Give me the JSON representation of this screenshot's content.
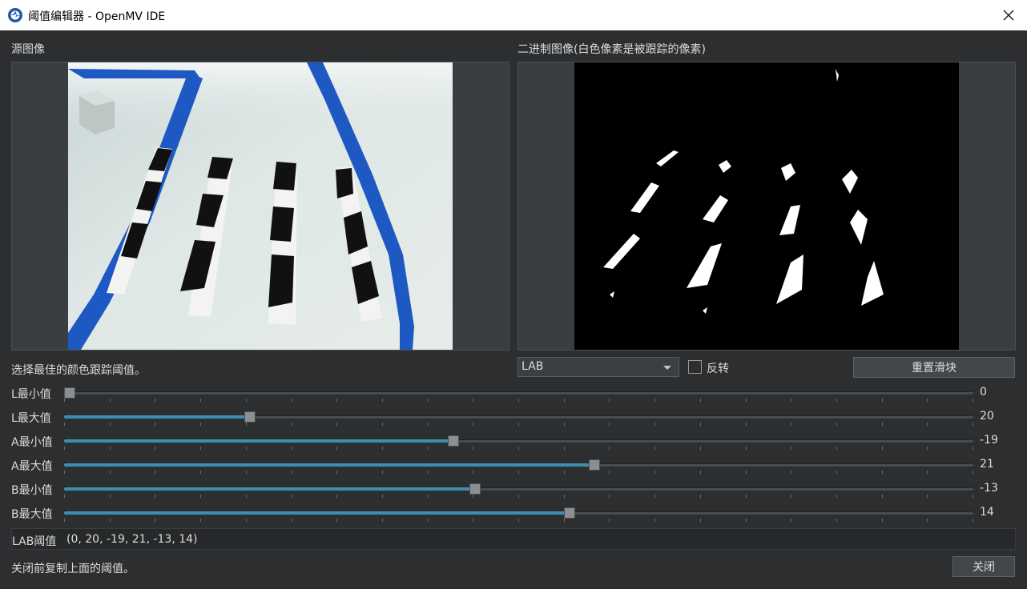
{
  "window": {
    "title": "阈值编辑器 - OpenMV IDE",
    "close_glyph": "✕"
  },
  "source_image": {
    "label": "源图像"
  },
  "binary_image": {
    "label": "二进制图像(白色像素是被跟踪的像素)"
  },
  "hint": "选择最佳的颜色跟踪阈值。",
  "color_space": {
    "selected": "LAB",
    "options": [
      "LAB"
    ]
  },
  "invert": {
    "label": "反转",
    "checked": false
  },
  "reset_button": "重置滑块",
  "sliders": [
    {
      "label": "L最小值",
      "value": "0",
      "fraction": 0.006
    },
    {
      "label": "L最大值",
      "value": "20",
      "fraction": 0.204
    },
    {
      "label": "A最小值",
      "value": "-19",
      "fraction": 0.428
    },
    {
      "label": "A最大值",
      "value": "21",
      "fraction": 0.583
    },
    {
      "label": "B最小值",
      "value": "-13",
      "fraction": 0.452
    },
    {
      "label": "B最大值",
      "value": "14",
      "fraction": 0.556
    }
  ],
  "threshold": {
    "label": "LAB阈值",
    "value": "(0, 20, -19, 21, -13, 14)"
  },
  "footer": {
    "hint": "关闭前复制上面的阈值。",
    "close_button": "关闭"
  },
  "colors": {
    "background": "#2c2e30",
    "slider_fill": "#3b8fb0",
    "tape_blue": "#1e58c2"
  }
}
